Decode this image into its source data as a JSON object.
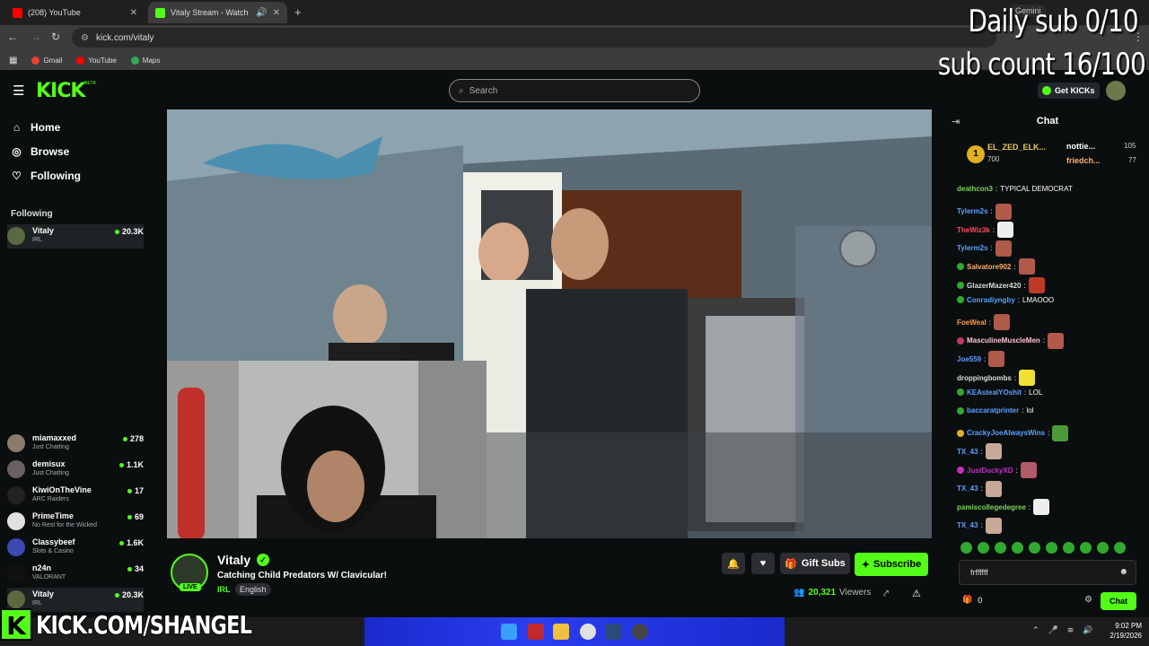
{
  "browser": {
    "tabs": [
      {
        "title": "(208) YouTube",
        "active": false,
        "favicon_color": "#ff0000"
      },
      {
        "title": "Vitaly Stream - Watch Live on Kick",
        "active": true,
        "favicon_color": "#53fc18"
      }
    ],
    "url": "kick.com/vitaly",
    "bookmarks": [
      {
        "label": "Gmail",
        "color": "#ea4335"
      },
      {
        "label": "YouTube",
        "color": "#ff0000"
      },
      {
        "label": "Maps",
        "color": "#34a853"
      }
    ],
    "gemini_label": "Gemini"
  },
  "overlay": {
    "daily_sub": "Daily sub 0/10",
    "sub_count": "sub count 16/100"
  },
  "header": {
    "logo": "KICK",
    "logo_beta": "BETA",
    "search_placeholder": "Search",
    "get_kicks": "Get KICKs"
  },
  "sidebar": {
    "nav": [
      {
        "label": "Home",
        "icon": "home-icon"
      },
      {
        "label": "Browse",
        "icon": "compass-icon"
      },
      {
        "label": "Following",
        "icon": "heart-icon"
      }
    ],
    "following_heading": "Following",
    "channels": [
      {
        "name": "Vitaly",
        "category": "IRL",
        "viewers": "20.3K",
        "color": "#5a6a40"
      },
      {
        "name": "miamaxxed",
        "category": "Just Chatting",
        "viewers": "278",
        "color": "#8a7a6a"
      },
      {
        "name": "demisux",
        "category": "Just Chatting",
        "viewers": "1.1K",
        "color": "#6a6060"
      },
      {
        "name": "KiwiOnTheVine",
        "category": "ARC Raiders",
        "viewers": "17",
        "color": "#222222"
      },
      {
        "name": "PrimeTime",
        "category": "No Rest for the Wicked",
        "viewers": "69",
        "color": "#e0e0e0"
      },
      {
        "name": "Classybeef",
        "category": "Slots & Casino",
        "viewers": "1.6K",
        "color": "#3a4ab0"
      },
      {
        "name": "n24n",
        "category": "VALORANT",
        "viewers": "34",
        "color": "#111111"
      },
      {
        "name": "Vitaly",
        "category": "IRL",
        "viewers": "20.3K",
        "color": "#5a6a40"
      }
    ]
  },
  "stream": {
    "streamer": "Vitaly",
    "title": "Catching Child Predators W/ Clavicular!",
    "category": "IRL",
    "language": "English",
    "live_label": "LIVE",
    "viewers": "20,321",
    "viewers_label": "Viewers",
    "gift_subs": "Gift Subs",
    "subscribe": "Subscribe"
  },
  "chat": {
    "title": "Chat",
    "pinned": {
      "first_name": "EL_ZED_ELK...",
      "first_amount": "700",
      "rank": "1",
      "second_name": "nottie...",
      "second_amount": "105",
      "third_name": "friedch...",
      "third_amount": "77"
    },
    "messages": [
      {
        "user": "deathcon3",
        "color": "#7ad45a",
        "text": "TYPICAL DEMOCRAT",
        "emote": "",
        "badge": ""
      },
      {
        "user": "Tylerm2s",
        "color": "#5aa0ff",
        "text": "",
        "emote": "#b05a4a",
        "badge": ""
      },
      {
        "user": "TheWiz3k",
        "color": "#ff4a5a",
        "text": "",
        "emote": "#eeeeee",
        "badge": ""
      },
      {
        "user": "Tylerm2s",
        "color": "#5aa0ff",
        "text": "",
        "emote": "#b05a4a",
        "badge": ""
      },
      {
        "user": "Salvatore902",
        "color": "#ffb070",
        "text": "",
        "emote": "#b05a4a",
        "badge": "#2faa2f"
      },
      {
        "user": "GlazerMazer420",
        "color": "#dddddd",
        "text": "",
        "emote": "#c03a2a",
        "badge": "#2faa2f"
      },
      {
        "user": "Conradiyngby",
        "color": "#5aa0ff",
        "text": "LMAOOO",
        "emote": "",
        "badge": "#2faa2f"
      },
      {
        "user": "FoeWeal",
        "color": "#ff9a4a",
        "text": "",
        "emote": "#b05a4a",
        "badge": ""
      },
      {
        "user": "MasculineMuscleMen",
        "color": "#ffc0d0",
        "text": "",
        "emote": "#b05a4a",
        "badge": "#c03a6a"
      },
      {
        "user": "Joe559",
        "color": "#5aa0ff",
        "text": "",
        "emote": "#b05a4a",
        "badge": ""
      },
      {
        "user": "droppingbombs",
        "color": "#dddddd",
        "text": "",
        "emote": "#f0e030",
        "badge": ""
      },
      {
        "user": "KEAstealYOshit",
        "color": "#5aa0ff",
        "text": "LOL",
        "emote": "",
        "badge": "#2faa2f"
      },
      {
        "user": "baccaratprinter",
        "color": "#5aa0ff",
        "text": "lol",
        "emote": "",
        "badge": "#2faa2f"
      },
      {
        "user": "CrackyJoeAlwaysWins",
        "color": "#5aa0ff",
        "text": "",
        "emote": "#4a9a3a",
        "badge": "#e0b020"
      },
      {
        "user": "TX_43",
        "color": "#5aa0ff",
        "text": "",
        "emote": "#c8a898",
        "badge": ""
      },
      {
        "user": "JustDuckyXD",
        "color": "#c030c0",
        "text": "",
        "emote": "#b05a6a",
        "badge": "#c030c0"
      },
      {
        "user": "TX_43",
        "color": "#5aa0ff",
        "text": "",
        "emote": "#c8a898",
        "badge": ""
      },
      {
        "user": "pamiscollegedegree",
        "color": "#7ad45a",
        "text": "",
        "emote": "#eeeeee",
        "badge": ""
      },
      {
        "user": "TX_43",
        "color": "#5aa0ff",
        "text": "",
        "emote": "#c8a898",
        "badge": ""
      }
    ],
    "input_value": "frffffff",
    "kicks_count": "0",
    "send": "Chat"
  },
  "watermark": {
    "k": "K",
    "text": "KICK.COM/SHANGEL"
  },
  "taskbar": {
    "time": "9:02 PM",
    "date": "2/19/2026"
  },
  "colors": {
    "accent": "#53fc18",
    "background": "#0b0e0f"
  }
}
